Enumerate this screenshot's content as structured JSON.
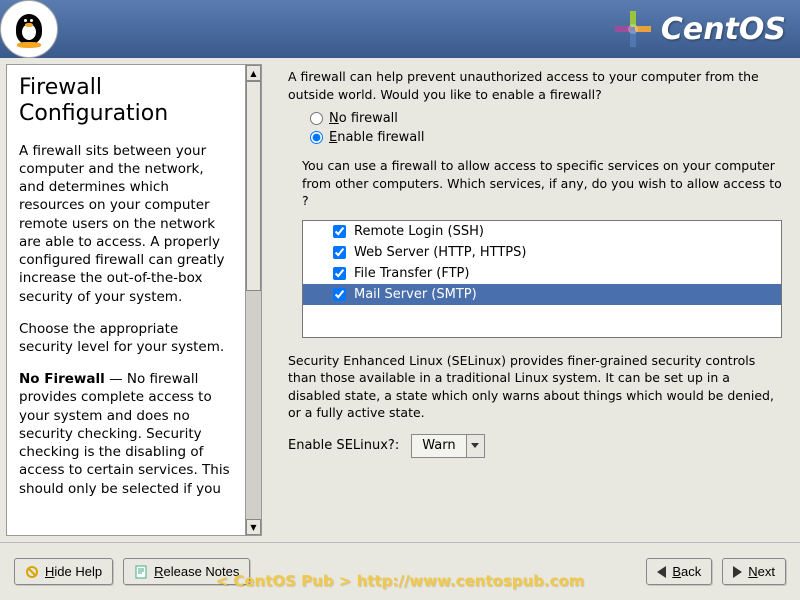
{
  "brand": "CentOS",
  "help": {
    "title": "Firewall Configuration",
    "paragraphs": [
      "A firewall sits between your computer and the network, and determines which resources on your computer remote users on the network are able to access. A properly configured firewall can greatly increase the out-of-the-box security of your system.",
      "Choose the appropriate security level for your system."
    ],
    "no_firewall_label": "No Firewall",
    "no_firewall_desc": " — No firewall provides complete access to your system and does no security checking. Security checking is the disabling of access to certain services. This should only be selected if you"
  },
  "intro_text": "A firewall can help prevent unauthorized access to your computer from the outside world.  Would you like to enable a firewall?",
  "radios": {
    "no_prefix": "N",
    "no_rest": "o firewall",
    "enable_prefix": "E",
    "enable_rest": "nable firewall",
    "selected": "enable"
  },
  "services": {
    "intro": "You can use a firewall to allow access to specific services on your computer from other computers. Which services, if any, do you wish to allow access to ?",
    "items": [
      {
        "label": "Remote Login (SSH)",
        "checked": true,
        "selected": false
      },
      {
        "label": "Web Server (HTTP, HTTPS)",
        "checked": true,
        "selected": false
      },
      {
        "label": "File Transfer (FTP)",
        "checked": true,
        "selected": false
      },
      {
        "label": "Mail Server (SMTP)",
        "checked": true,
        "selected": true
      }
    ]
  },
  "selinux": {
    "intro": "Security Enhanced Linux (SELinux) provides finer-grained security controls than those available in a traditional Linux system.  It can be set up in a disabled state, a state which only warns about things which would be denied, or a fully active state.",
    "label_pre": "Enable ",
    "label_ul": "S",
    "label_post": "ELinux?:",
    "value": "Warn"
  },
  "footer": {
    "hide_help_ul": "H",
    "hide_help_rest": "ide Help",
    "release_ul": "R",
    "release_rest": "elease Notes",
    "back_ul": "B",
    "back_rest": "ack",
    "next_ul": "N",
    "next_rest": "ext"
  },
  "watermark": "< CentOS Pub > http://www.centospub.com"
}
